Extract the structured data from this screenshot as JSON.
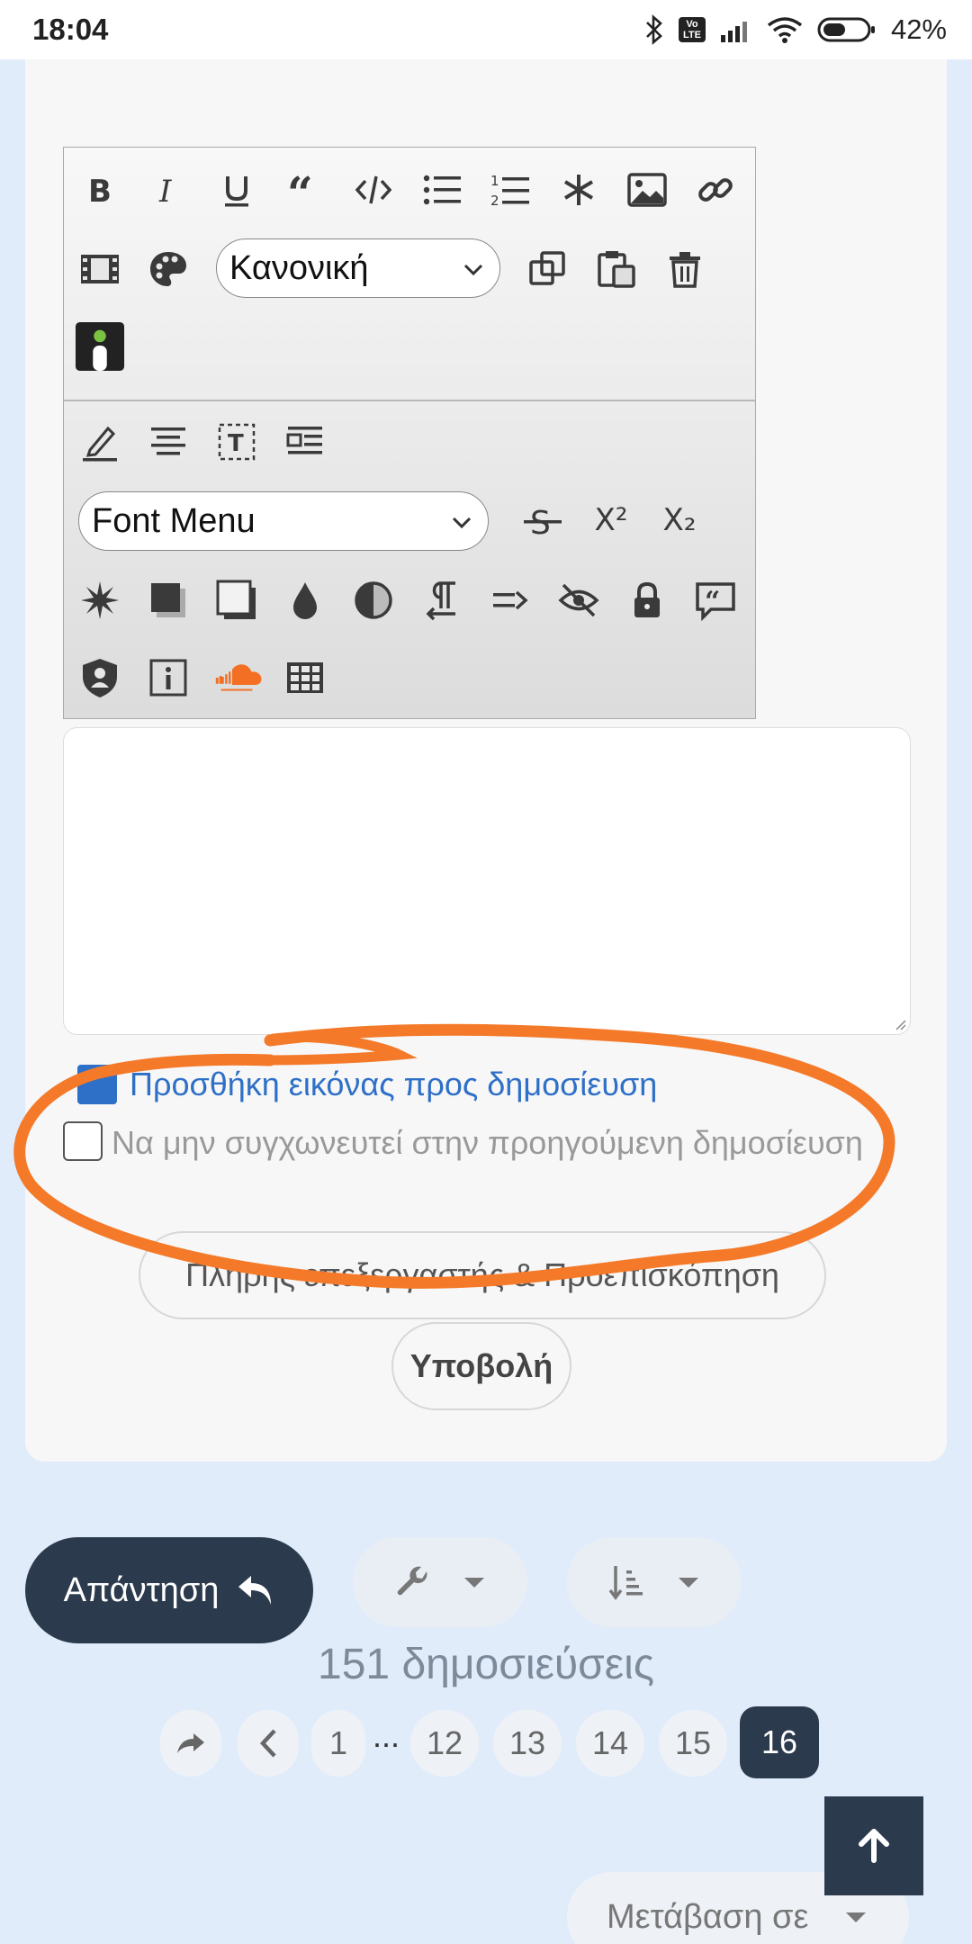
{
  "status_bar": {
    "time": "18:04",
    "battery": "42%",
    "network_badge": "Vo LTE"
  },
  "toolbar": {
    "format_select": "Κανονική",
    "font_select": "Font Menu",
    "superscript_glyph": "X²",
    "subscript_glyph": "X₂"
  },
  "post_form": {
    "add_image_link": "Προσθήκη εικόνας προς δημοσίευση",
    "no_merge_label": "Να μην συγχωνευτεί στην προηγούμενη δημοσίευση",
    "full_editor_button": "Πλήρης επεξεργαστής & Προεπισκόπηση",
    "submit_button": "Υποβολή"
  },
  "thread": {
    "reply_button": "Απάντηση",
    "post_count": "151 δημοσιεύσεις",
    "pages": [
      "1",
      "12",
      "13",
      "14",
      "15",
      "16"
    ],
    "ellipsis": "...",
    "current_page": "16",
    "goto_label": "Μετάβαση σε"
  },
  "colors": {
    "accent_dark": "#2c3a4d",
    "link_blue": "#2e6fc7",
    "annotation_orange": "#f47a2a"
  }
}
